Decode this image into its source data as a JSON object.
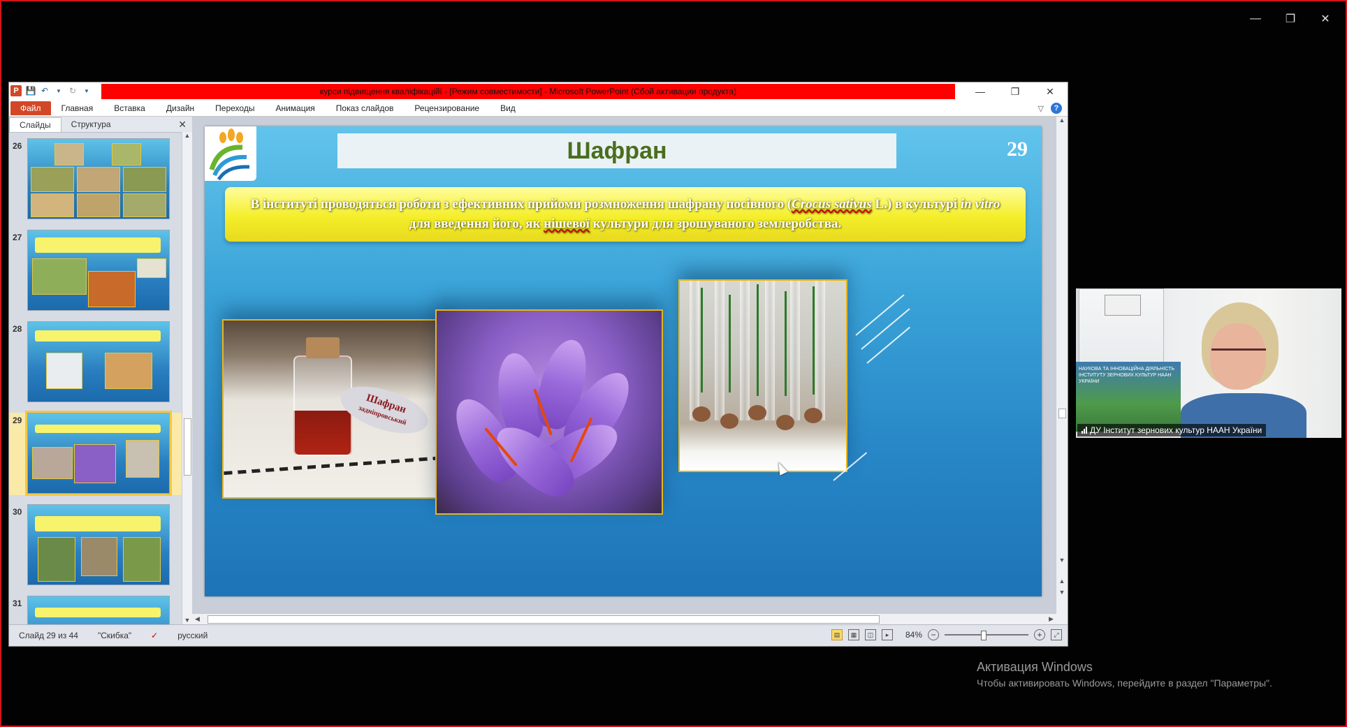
{
  "host": {
    "controls": [
      "minimize-icon",
      "restore-icon",
      "close-icon"
    ]
  },
  "window": {
    "title": "курси підвищення кваліфікаційї - [Режим совместимости] - Microsoft PowerPoint (Сбой активации продукта)",
    "ribbon": {
      "file": "Файл",
      "tabs": [
        "Главная",
        "Вставка",
        "Дизайн",
        "Переходы",
        "Анимация",
        "Показ слайдов",
        "Рецензирование",
        "Вид"
      ]
    },
    "panel": {
      "tabs": [
        "Слайды",
        "Структура"
      ],
      "slides": [
        {
          "num": "26"
        },
        {
          "num": "27"
        },
        {
          "num": "28"
        },
        {
          "num": "29"
        },
        {
          "num": "30"
        },
        {
          "num": "31"
        }
      ]
    },
    "slide": {
      "title": "Шафран",
      "number": "29",
      "banner_parts": {
        "p1": "В інституті  проводяться  роботи  з ефективних прийоми розмноження шафрану  посівного (",
        "p2": "Crocus sativus",
        "p3": " L.) в культурі  ",
        "p4": "in vitro",
        "p5": " для введення його, як ",
        "p6": "нішевої",
        "p7": " культури  для зрошуваного землеробства."
      },
      "jar_label": "Шафран",
      "jar_label_sub": "задніпровський"
    },
    "status": {
      "slide_of": "Слайд 29 из 44",
      "theme": "\"Скибка\"",
      "language": "русский",
      "zoom": "84%"
    }
  },
  "webcam": {
    "caption": "ДУ Інститут зернових культур НААН України",
    "map_text": "НАУКОВА ТА ІННОВАЦІЙНА ДІЯЛЬНІСТЬ ІНСТИТУТУ ЗЕРНОВИХ КУЛЬТУР НААН УКРАЇНИ"
  },
  "activation": {
    "title": "Активация Windows",
    "subtitle": "Чтобы активировать Windows, перейдите в раздел \"Параметры\"."
  }
}
